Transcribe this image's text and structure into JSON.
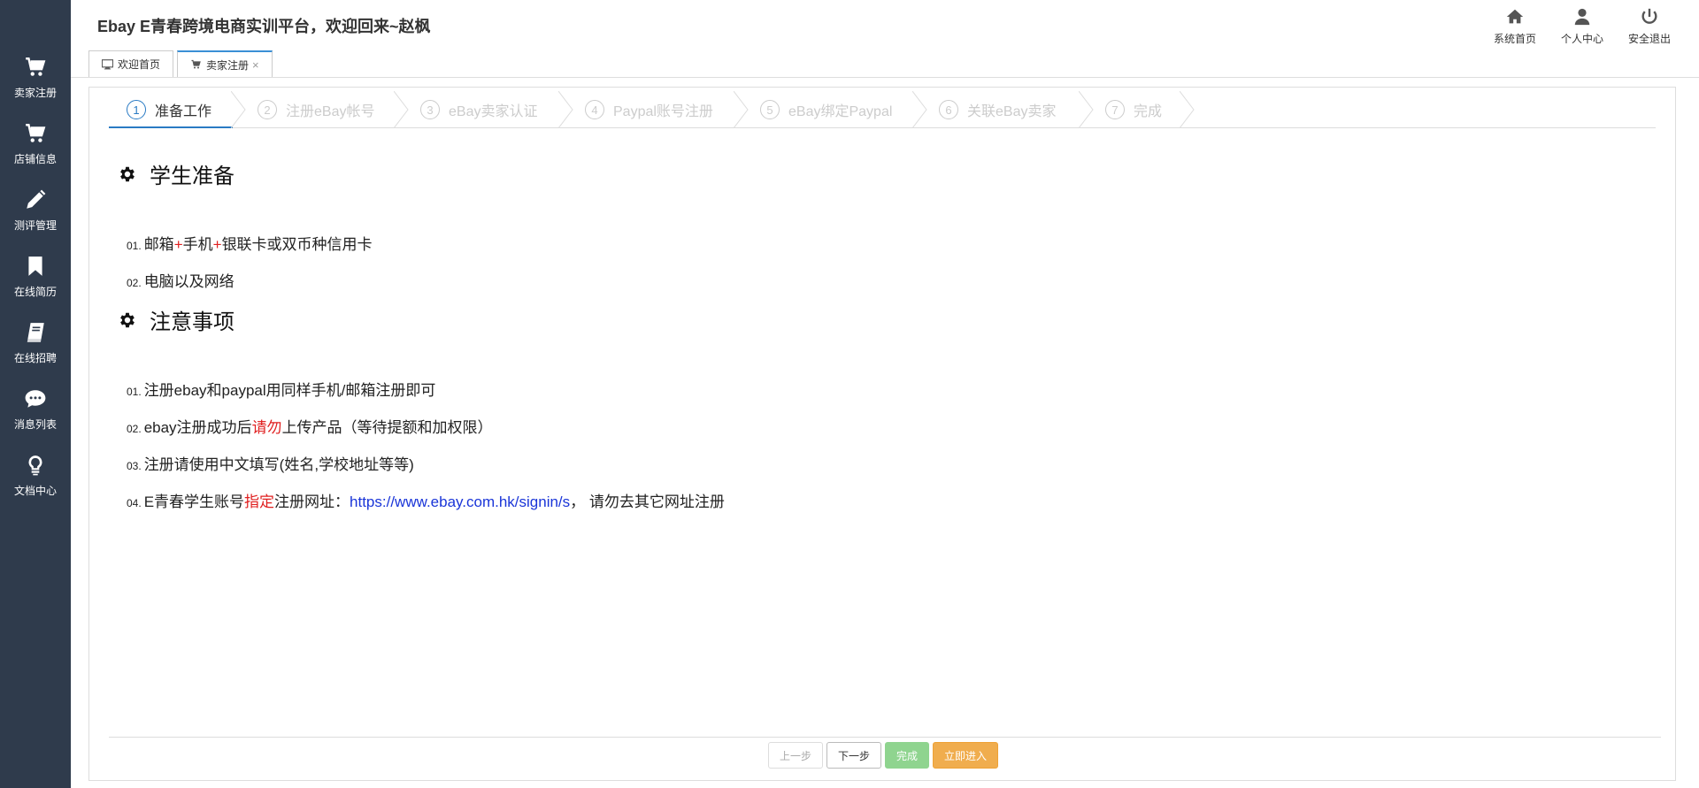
{
  "sidebar": {
    "items": [
      {
        "label": "卖家注册",
        "icon": "cart-icon"
      },
      {
        "label": "店铺信息",
        "icon": "cart-icon"
      },
      {
        "label": "测评管理",
        "icon": "pencil-icon"
      },
      {
        "label": "在线简历",
        "icon": "bookmark-icon"
      },
      {
        "label": "在线招聘",
        "icon": "book-icon"
      },
      {
        "label": "消息列表",
        "icon": "chat-icon"
      },
      {
        "label": "文档中心",
        "icon": "lightbulb-icon"
      }
    ]
  },
  "header": {
    "title": "Ebay E青春跨境电商实训平台，欢迎回来~赵枫",
    "nav": [
      {
        "label": "系统首页",
        "icon": "home-icon"
      },
      {
        "label": "个人中心",
        "icon": "user-icon"
      },
      {
        "label": "安全退出",
        "icon": "power-icon"
      }
    ]
  },
  "tabs": [
    {
      "label": "欢迎首页",
      "icon": "monitor-icon"
    },
    {
      "label": "卖家注册",
      "icon": "cart-icon",
      "close": "×"
    }
  ],
  "steps": [
    {
      "num": "1",
      "label": "准备工作"
    },
    {
      "num": "2",
      "label": "注册eBay帐号"
    },
    {
      "num": "3",
      "label": "eBay卖家认证"
    },
    {
      "num": "4",
      "label": "Paypal账号注册"
    },
    {
      "num": "5",
      "label": "eBay绑定Paypal"
    },
    {
      "num": "6",
      "label": "关联eBay卖家"
    },
    {
      "num": "7",
      "label": "完成"
    }
  ],
  "section1": {
    "title": "学生准备",
    "items": [
      {
        "n": "01.",
        "a": "邮箱",
        "plus1": "+",
        "b": "手机",
        "plus2": "+",
        "c": "银联卡或双币种信用卡"
      },
      {
        "n": "02.",
        "text": "电脑以及网络"
      }
    ]
  },
  "section2": {
    "title": "注意事项",
    "items": [
      {
        "n": "01.",
        "text": "注册ebay和paypal用同样手机/邮箱注册即可"
      },
      {
        "n": "02.",
        "a": "ebay注册成功后",
        "red": "请勿",
        "b": "上传产品（等待提额和加权限）"
      },
      {
        "n": "03.",
        "text": "注册请使用中文填写(姓名,学校地址等等)"
      },
      {
        "n": "04.",
        "a": "E青春学生账号",
        "red": "指定",
        "b": "注册网址：",
        "link": "https://www.ebay.com.hk/signin/s",
        "c": "， 请勿去其它网址注册"
      }
    ]
  },
  "footer": {
    "prev": "上一步",
    "next": "下一步",
    "done": "完成",
    "enter": "立即进入"
  },
  "colors": {
    "sidebar": "#2f3b4c",
    "step_active": "#2a7bc4",
    "red": "#e02020",
    "link": "#1a35d8",
    "done": "#8fd48f",
    "enter": "#f0ad4e"
  }
}
